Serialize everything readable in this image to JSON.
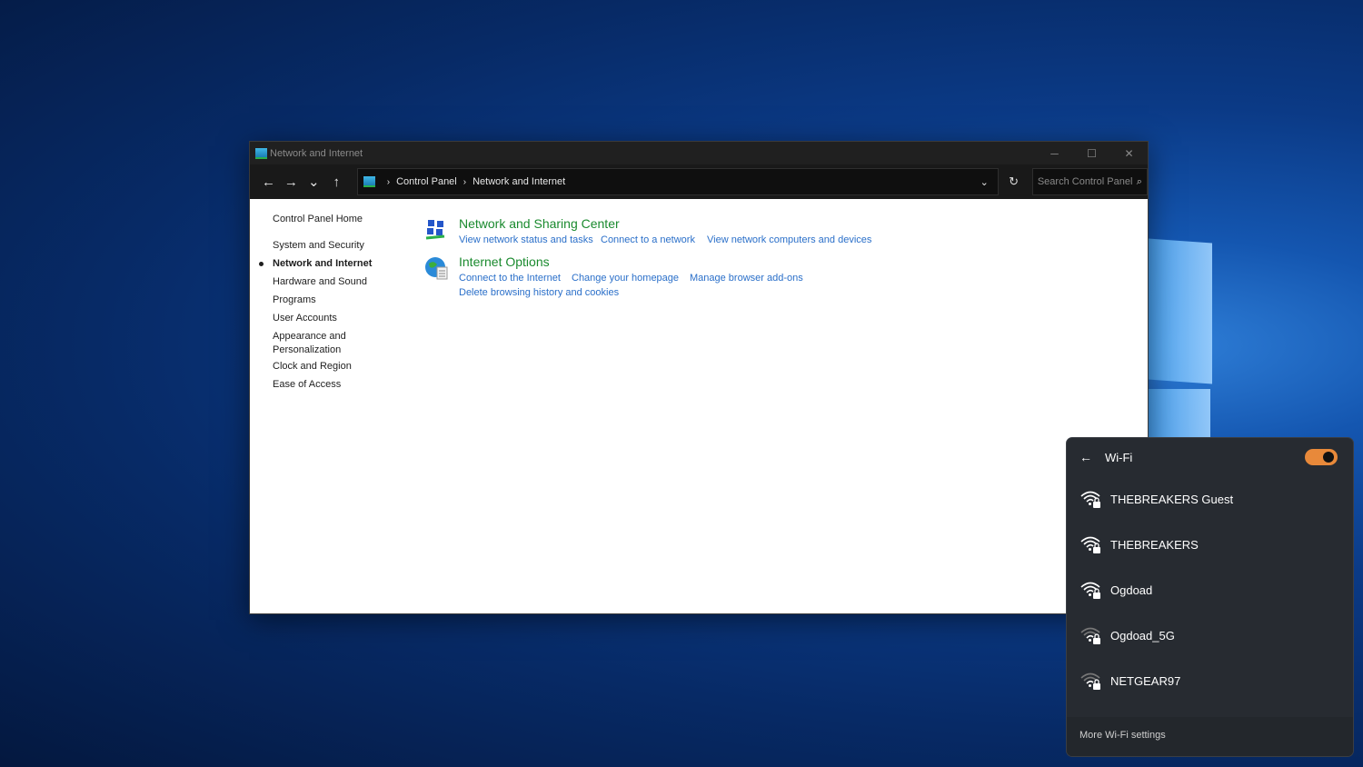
{
  "window": {
    "title": "Network and Internet",
    "minimize": "─",
    "maximize": "☐",
    "close": "✕"
  },
  "nav": {
    "back": "←",
    "forward": "→",
    "recent": "⌄",
    "up": "↑",
    "breadcrumb": [
      "Control Panel",
      "Network and Internet"
    ],
    "separator": "›",
    "dropdown": "⌄",
    "refresh": "↻",
    "search_placeholder": "Search Control Panel",
    "search_icon": "⌕"
  },
  "sidebar": {
    "home": "Control Panel Home",
    "items": [
      "System and Security",
      "Network and Internet",
      "Hardware and Sound",
      "Programs",
      "User Accounts",
      "Appearance and Personalization",
      "Clock and Region",
      "Ease of Access"
    ],
    "active": "Network and Internet"
  },
  "categories": [
    {
      "title": "Network and Sharing Center",
      "icon": "network-icon",
      "links": [
        "View network status and tasks",
        "Connect to a network",
        "View network computers and devices"
      ]
    },
    {
      "title": "Internet Options",
      "icon": "globe-icon",
      "links": [
        "Connect to the Internet",
        "Change your homepage",
        "Manage browser add-ons",
        "Delete browsing history and cookies"
      ]
    }
  ],
  "wifi": {
    "title": "Wi-Fi",
    "enabled": true,
    "accent": "#e8893a",
    "networks": [
      {
        "ssid": "THEBREAKERS Guest",
        "signal": "strong",
        "secured": true
      },
      {
        "ssid": "THEBREAKERS",
        "signal": "strong",
        "secured": true
      },
      {
        "ssid": "Ogdoad",
        "signal": "strong",
        "secured": true
      },
      {
        "ssid": "Ogdoad_5G",
        "signal": "weak",
        "secured": true
      },
      {
        "ssid": "NETGEAR97",
        "signal": "weak",
        "secured": true
      }
    ],
    "more_settings": "More Wi-Fi settings"
  }
}
